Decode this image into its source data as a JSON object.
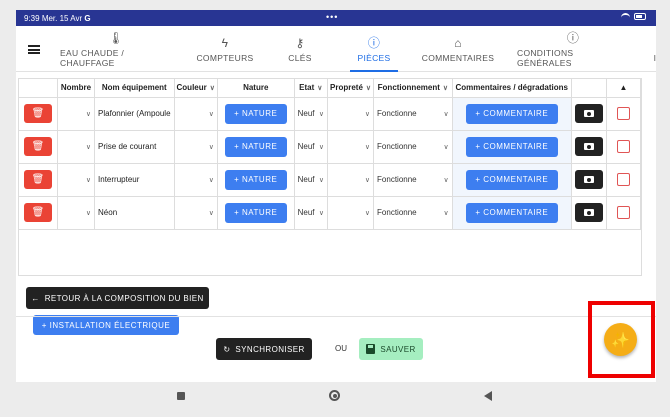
{
  "status": {
    "time": "9:39",
    "date": "Mer. 15 Avr",
    "app_glyph": "G",
    "dots": "•••"
  },
  "tabs": [
    {
      "label": "EAU CHAUDE / CHAUFFAGE",
      "icon": "thermometer-icon",
      "glyph": "🌡"
    },
    {
      "label": "COMPTEURS",
      "icon": "flash-icon",
      "glyph": "ϟ"
    },
    {
      "label": "CLÉS",
      "icon": "key-icon",
      "glyph": "⚷"
    },
    {
      "label": "PIÈCES",
      "icon": "info-icon",
      "glyph": "ⓘ",
      "active": true
    },
    {
      "label": "COMMENTAIRES",
      "icon": "home-icon",
      "glyph": "⌂"
    },
    {
      "label": "CONDITIONS GÉNÉRALES",
      "icon": "info-icon",
      "glyph": "ⓘ"
    }
  ],
  "table": {
    "headers": {
      "nombre": "Nombre",
      "nom": "Nom équipement",
      "couleur": "Couleur",
      "nature": "Nature",
      "etat": "Etat",
      "proprete": "Propreté",
      "fonctionnement": "Fonctionnement",
      "commentaires": "Commentaires / dégradations",
      "warning": "▲"
    },
    "rows": [
      {
        "nom": "Plafonnier (Ampoule",
        "etat": "Neuf",
        "fonctionnement": "Fonctionne"
      },
      {
        "nom": "Prise de courant",
        "etat": "Neuf",
        "fonctionnement": "Fonctionne"
      },
      {
        "nom": "Interrupteur",
        "etat": "Neuf",
        "fonctionnement": "Fonctionne"
      },
      {
        "nom": "Néon",
        "etat": "Neuf",
        "fonctionnement": "Fonctionne"
      }
    ],
    "nature_btn": "+ NATURE",
    "comment_btn": "+ COMMENTAIRE"
  },
  "buttons": {
    "installation": "+ INSTALLATION ÉLECTRIQUE",
    "back": "RETOUR À LA COMPOSITION DU BIEN",
    "sync": "SYNCHRONISER",
    "ou": "OU",
    "save": "SAUVER"
  },
  "colors": {
    "accent": "#1e6de5",
    "delete": "#ea4335",
    "fab": "#f5ad16",
    "save": "#a5eec0",
    "highlight": "#ee0000"
  }
}
